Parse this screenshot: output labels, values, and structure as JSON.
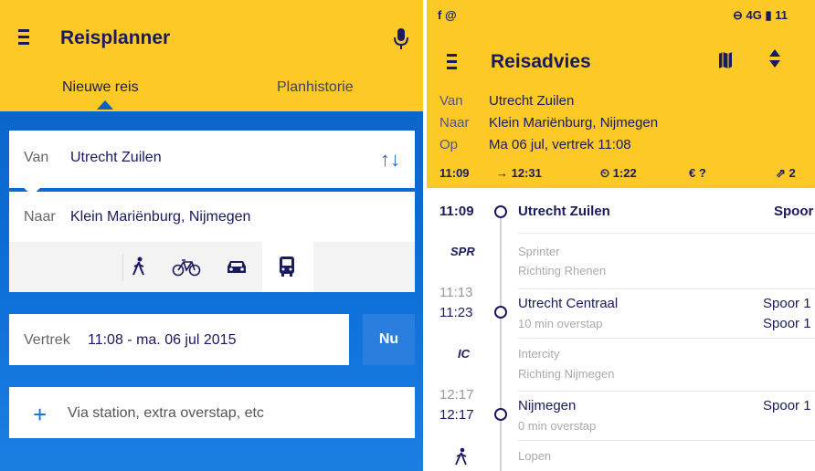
{
  "left": {
    "title": "Reisplanner",
    "tabs": [
      "Nieuwe reis",
      "Planhistorie"
    ],
    "van_label": "Van",
    "van_value": "Utrecht Zuilen",
    "naar_label": "Naar",
    "naar_value": "Klein Mariënburg, Nijmegen",
    "modes": [
      "walk-icon",
      "bike-icon",
      "car-icon",
      "bus-icon"
    ],
    "vertrek_label": "Vertrek",
    "vertrek_value": "11:08 - ma. 06 jul 2015",
    "nu_button": "Nu",
    "via_placeholder": "Via station, extra overstap, etc"
  },
  "right": {
    "status_left": "f  @",
    "status_right": "⊖ 4G ▮ 11",
    "title": "Reisadvies",
    "van_label": "Van",
    "van_value": "Utrecht Zuilen",
    "naar_label": "Naar",
    "naar_value": "Klein Mariënburg, Nijmegen",
    "op_label": "Op",
    "op_value": "Ma 06 jul, vertrek 11:08",
    "meta": {
      "depart": "11:09",
      "arrive": "→ 12:31",
      "duration": "⏲ 1:22",
      "price": "€ ?",
      "transfers": "⇗ 2"
    },
    "timeline": {
      "stop1_time": "11:09",
      "stop1_name": "Utrecht Zuilen",
      "stop1_spoor": "Spoor",
      "leg1_type": "SPR",
      "leg1_name": "Sprinter",
      "leg1_dir": "Richting Rhenen",
      "stop2_arr": "11:13",
      "stop2_dep": "11:23",
      "stop2_name": "Utrecht Centraal",
      "stop2_sub": "10 min overstap",
      "stop2_spoor1": "Spoor 1",
      "stop2_spoor2": "Spoor 1",
      "leg2_type": "IC",
      "leg2_name": "Intercity",
      "leg2_dir": "Richting Nijmegen",
      "stop3_arr": "12:17",
      "stop3_dep": "12:17",
      "stop3_name": "Nijmegen",
      "stop3_sub": "0 min overstap",
      "stop3_spoor": "Spoor 1",
      "leg3_name": "Lopen"
    }
  },
  "colors": {
    "accent_yellow": "#fcc927",
    "ns_blue": "#0a5fc4",
    "navy": "#1a1a5e"
  }
}
